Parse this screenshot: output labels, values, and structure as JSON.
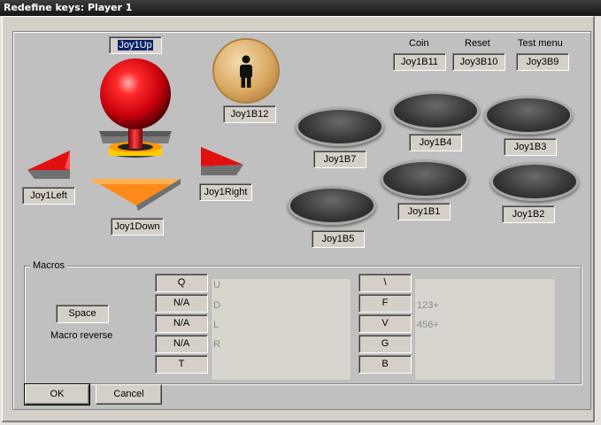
{
  "window": {
    "title": "Redefine keys: Player 1"
  },
  "joystick": {
    "up": "Joy1Up",
    "down": "Joy1Down",
    "left": "Joy1Left",
    "right": "Joy1Right"
  },
  "player_button": {
    "label": "Joy1B12"
  },
  "system": {
    "coin_label": "Coin",
    "coin_value": "Joy1B11",
    "reset_label": "Reset",
    "reset_value": "Joy3B10",
    "test_label": "Test menu",
    "test_value": "Joy3B9"
  },
  "buttons": {
    "b7": "Joy1B7",
    "b4": "Joy1B4",
    "b3": "Joy1B3",
    "b1": "Joy1B1",
    "b2": "Joy1B2",
    "b5": "Joy1B5"
  },
  "macros": {
    "title": "Macros",
    "key": "Space",
    "reverse_label": "Macro reverse",
    "left_keys": [
      "Q",
      "N/A",
      "N/A",
      "N/A",
      "T"
    ],
    "left_hints": [
      "U",
      "D",
      "L",
      "R"
    ],
    "right_keys": [
      "\\",
      "F",
      "V",
      "G",
      "B"
    ],
    "right_hints": [
      "123+",
      "456+"
    ]
  },
  "actions": {
    "ok": "OK",
    "cancel": "Cancel"
  },
  "colors": {
    "accent": "#0a246a",
    "titlebar": "#1e1e1e",
    "ball": "#e0101a",
    "arrow_red": "#d81010",
    "arrow_orange": "#ff8a1a"
  }
}
